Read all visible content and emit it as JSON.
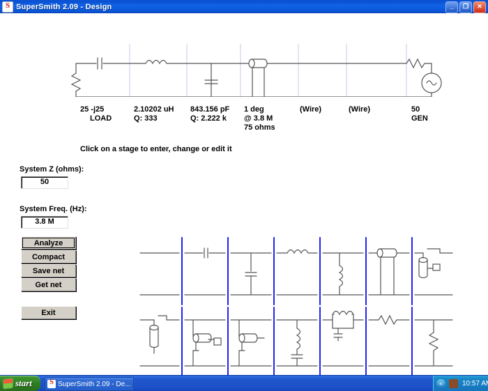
{
  "window": {
    "title": "SuperSmith 2.09 - Design",
    "icon": "supersmith-icon",
    "minimize_label": "_",
    "restore_label": "❐",
    "close_label": "✕"
  },
  "schematic": {
    "hint": "Click on a stage to enter, change or edit it",
    "stages": [
      {
        "line1": "25  -j25",
        "line2": "LOAD",
        "line3": "",
        "type": "resistor-load"
      },
      {
        "line1": "2.10202 uH",
        "line2": "Q: 333",
        "line3": "",
        "type": "series-inductor"
      },
      {
        "line1": "843.156 pF",
        "line2": "Q: 2.222 k",
        "line3": "",
        "type": "shunt-capacitor"
      },
      {
        "line1": "1  deg",
        "line2": "@ 3.8 M",
        "line3": "75  ohms",
        "type": "shunt-stub"
      },
      {
        "line1": "(Wire)",
        "line2": "",
        "line3": "",
        "type": "wire"
      },
      {
        "line1": "(Wire)",
        "line2": "",
        "line3": "",
        "type": "wire"
      },
      {
        "line1": "50",
        "line2": "GEN",
        "line3": "",
        "type": "generator"
      }
    ]
  },
  "fields": [
    {
      "label": "System Z (ohms):",
      "value": "50",
      "name": "system-z"
    },
    {
      "label": "System Freq. (Hz):",
      "value": "3.8 M",
      "name": "system-freq"
    }
  ],
  "buttons": [
    {
      "label": "Analyze",
      "name": "analyze-button",
      "focused": true
    },
    {
      "label": "Compact",
      "name": "compact-button",
      "focused": false
    },
    {
      "label": "Save net",
      "name": "save-net-button",
      "focused": false
    },
    {
      "label": "Get net",
      "name": "get-net-button",
      "focused": false
    },
    {
      "label": "Exit",
      "name": "exit-button",
      "focused": false
    }
  ],
  "palette": {
    "separator_color": "#2222ee",
    "row1": [
      "wire",
      "series-capacitor",
      "shunt-capacitor",
      "series-inductor",
      "shunt-inductor",
      "shunt-stub",
      "series-stub-open"
    ],
    "row2": [
      "series-stub",
      "shunt-stub-shorted",
      "series-open-stub",
      "shunt-series-lc",
      "series-parallel-lc",
      "series-resistor",
      "shunt-resistor"
    ]
  },
  "taskbar": {
    "start_label": "start",
    "task_label": "SuperSmith 2.09 - De...",
    "clock": "10:57 AM",
    "tray_chevron": "«"
  }
}
